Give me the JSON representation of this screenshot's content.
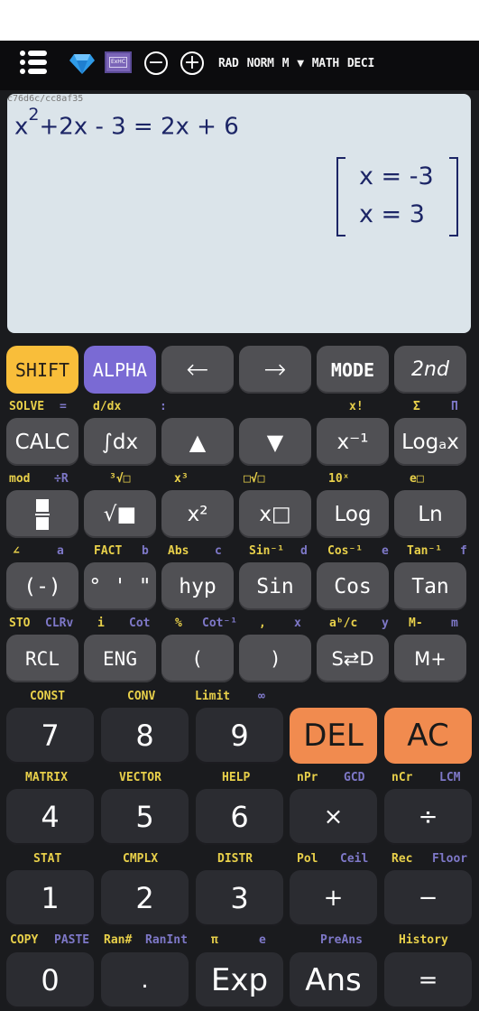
{
  "statusbar": {
    "icons": [
      "menu-icon",
      "diamond-icon",
      "excalc-icon",
      "zoom-out-icon",
      "zoom-in-icon"
    ],
    "zoom_out": "−",
    "zoom_in": "+",
    "indicators": [
      "RAD",
      "NORM",
      "M",
      "▼",
      "MATH",
      "DECI"
    ]
  },
  "display": {
    "hash": "c76d6c/cc8af35",
    "expression_base": "x",
    "expression_exp": "2",
    "expression_rest": "+2x - 3 = 2x + 6",
    "results": [
      "x = -3",
      "x = 3"
    ]
  },
  "keys": {
    "row1": [
      "SHIFT",
      "ALPHA",
      "←",
      "→",
      "MODE",
      "2nd"
    ],
    "row1_sub": [
      {
        "text": "SOLVE",
        "c": "y"
      },
      {
        "text": "=",
        "c": "p"
      },
      {
        "text": "d/dx",
        "c": "y"
      },
      {
        "text": ":",
        "c": "p"
      },
      {
        "text": "x!",
        "c": "y"
      },
      {
        "text": "Σ",
        "c": "y"
      },
      {
        "text": "Π",
        "c": "p"
      }
    ],
    "row2": [
      "CALC",
      "∫dx",
      "▲",
      "▼",
      "x⁻¹",
      "Logₐx"
    ],
    "row2_sub": [
      {
        "text": "mod",
        "c": "y"
      },
      {
        "text": "÷R",
        "c": "p"
      },
      {
        "text": "³√□",
        "c": "y"
      },
      {
        "text": "x³",
        "c": "y"
      },
      {
        "text": "□√□",
        "c": "y"
      },
      {
        "text": "10ˣ",
        "c": "y"
      },
      {
        "text": "e□",
        "c": "y"
      }
    ],
    "row3": [
      "fraction",
      "√■",
      "x²",
      "x□",
      "Log",
      "Ln"
    ],
    "row3_sub": [
      {
        "text": "∠",
        "c": "y"
      },
      {
        "text": "a",
        "c": "p"
      },
      {
        "text": "FACT",
        "c": "y"
      },
      {
        "text": "b",
        "c": "p"
      },
      {
        "text": "Abs",
        "c": "y"
      },
      {
        "text": "c",
        "c": "p"
      },
      {
        "text": "Sin⁻¹",
        "c": "y"
      },
      {
        "text": "d",
        "c": "p"
      },
      {
        "text": "Cos⁻¹",
        "c": "y"
      },
      {
        "text": "e",
        "c": "p"
      },
      {
        "text": "Tan⁻¹",
        "c": "y"
      },
      {
        "text": "f",
        "c": "p"
      }
    ],
    "row4": [
      "(-)",
      "° ' \"",
      "hyp",
      "Sin",
      "Cos",
      "Tan"
    ],
    "row4_sub": [
      {
        "text": "STO",
        "c": "y"
      },
      {
        "text": "CLRv",
        "c": "p"
      },
      {
        "text": "i",
        "c": "y"
      },
      {
        "text": "Cot",
        "c": "p"
      },
      {
        "text": "%",
        "c": "y"
      },
      {
        "text": "Cot⁻¹",
        "c": "p"
      },
      {
        "text": ",",
        "c": "y"
      },
      {
        "text": "x",
        "c": "p"
      },
      {
        "text": "aᵇ/c",
        "c": "y"
      },
      {
        "text": "y",
        "c": "p"
      },
      {
        "text": "M-",
        "c": "y"
      },
      {
        "text": "m",
        "c": "p"
      }
    ],
    "row5": [
      "RCL",
      "ENG",
      "(",
      ")",
      "S⇄D",
      "M+"
    ],
    "row5_sub": [
      {
        "text": "CONST",
        "c": "y"
      },
      {
        "text": "CONV",
        "c": "y"
      },
      {
        "text": "Limit",
        "c": "y"
      },
      {
        "text": "∞",
        "c": "p"
      }
    ],
    "row6": [
      "7",
      "8",
      "9",
      "DEL",
      "AC"
    ],
    "row6_sub": [
      {
        "text": "MATRIX",
        "c": "y"
      },
      {
        "text": "VECTOR",
        "c": "y"
      },
      {
        "text": "HELP",
        "c": "y"
      },
      {
        "text": "nPr",
        "c": "y"
      },
      {
        "text": "GCD",
        "c": "p"
      },
      {
        "text": "nCr",
        "c": "y"
      },
      {
        "text": "LCM",
        "c": "p"
      }
    ],
    "row7": [
      "4",
      "5",
      "6",
      "×",
      "÷"
    ],
    "row7_sub": [
      {
        "text": "STAT",
        "c": "y"
      },
      {
        "text": "CMPLX",
        "c": "y"
      },
      {
        "text": "DISTR",
        "c": "y"
      },
      {
        "text": "Pol",
        "c": "y"
      },
      {
        "text": "Ceil",
        "c": "p"
      },
      {
        "text": "Rec",
        "c": "y"
      },
      {
        "text": "Floor",
        "c": "p"
      }
    ],
    "row8": [
      "1",
      "2",
      "3",
      "+",
      "−"
    ],
    "row8_sub": [
      {
        "text": "COPY",
        "c": "y"
      },
      {
        "text": "PASTE",
        "c": "p"
      },
      {
        "text": "Ran#",
        "c": "y"
      },
      {
        "text": "RanInt",
        "c": "p"
      },
      {
        "text": "π",
        "c": "y"
      },
      {
        "text": "e",
        "c": "p"
      },
      {
        "text": "PreAns",
        "c": "p"
      },
      {
        "text": "History",
        "c": "y"
      }
    ],
    "row9": [
      "0",
      ".",
      "Exp",
      "Ans",
      "="
    ]
  }
}
